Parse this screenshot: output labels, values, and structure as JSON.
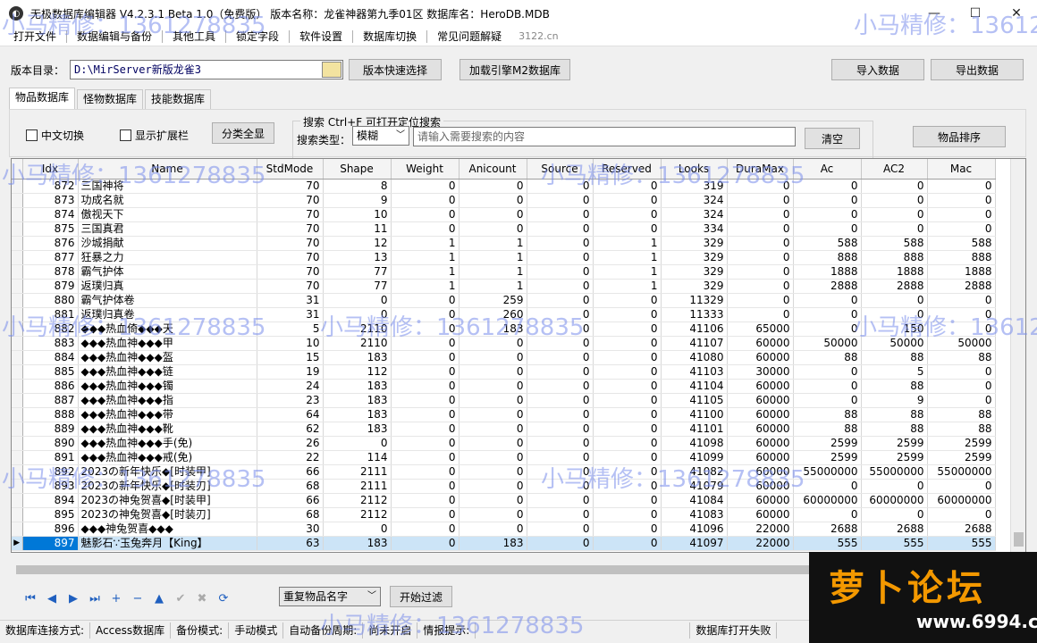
{
  "window": {
    "title": "无极数据库编辑器 V4.2.3.1    Beta 1.0（免费版）    版本名称：龙雀神器第九季01区    数据库名：HeroDB.MDB",
    "minimize": "—",
    "maximize": "☐",
    "close": "✕"
  },
  "menu": {
    "items": [
      "打开文件",
      "数据编辑与备份",
      "其他工具",
      "锁定字段",
      "软件设置",
      "数据库切换",
      "常见问题解疑"
    ],
    "website": "3122.cn"
  },
  "directory": {
    "label": "版本目录：",
    "value": "D:\\MirServer新版龙雀3",
    "quick_select": "版本快速选择",
    "load_engine": "加载引擎M2数据库",
    "import": "导入数据",
    "export": "导出数据"
  },
  "tabs": [
    "物品数据库",
    "怪物数据库",
    "技能数据库"
  ],
  "filters": {
    "chinese_toggle": "中文切换",
    "show_ext": "显示扩展栏",
    "show_all": "分类全显",
    "search_legend": "搜索   Ctrl+F 可打开定位搜索",
    "search_type_label": "搜索类型：",
    "search_type_value": "模糊",
    "search_placeholder": "请输入需要搜索的内容",
    "clear": "清空",
    "sort": "物品排序"
  },
  "table": {
    "columns": [
      "Idx",
      "Name",
      "StdMode",
      "Shape",
      "Weight",
      "Anicount",
      "Source",
      "Reserved",
      "Looks",
      "DuraMax",
      "Ac",
      "AC2",
      "Mac"
    ],
    "rows": [
      [
        "872",
        "三国神将",
        "70",
        "8",
        "0",
        "0",
        "0",
        "0",
        "319",
        "0",
        "0",
        "0",
        "0"
      ],
      [
        "873",
        "功成名就",
        "70",
        "9",
        "0",
        "0",
        "0",
        "0",
        "324",
        "0",
        "0",
        "0",
        "0"
      ],
      [
        "874",
        "傲视天下",
        "70",
        "10",
        "0",
        "0",
        "0",
        "0",
        "324",
        "0",
        "0",
        "0",
        "0"
      ],
      [
        "875",
        "三国真君",
        "70",
        "11",
        "0",
        "0",
        "0",
        "0",
        "334",
        "0",
        "0",
        "0",
        "0"
      ],
      [
        "876",
        "沙城捐献",
        "70",
        "12",
        "1",
        "1",
        "0",
        "1",
        "329",
        "0",
        "588",
        "588",
        "588"
      ],
      [
        "877",
        "狂暴之力",
        "70",
        "13",
        "1",
        "1",
        "0",
        "1",
        "329",
        "0",
        "888",
        "888",
        "888"
      ],
      [
        "878",
        "霸气护体",
        "70",
        "77",
        "1",
        "1",
        "0",
        "1",
        "329",
        "0",
        "1888",
        "1888",
        "1888"
      ],
      [
        "879",
        "返璞归真",
        "70",
        "77",
        "1",
        "1",
        "0",
        "1",
        "329",
        "0",
        "2888",
        "2888",
        "2888"
      ],
      [
        "880",
        "霸气护体卷",
        "31",
        "0",
        "0",
        "259",
        "0",
        "0",
        "11329",
        "0",
        "0",
        "0",
        "0"
      ],
      [
        "881",
        "返璞归真卷",
        "31",
        "0",
        "0",
        "260",
        "0",
        "0",
        "11333",
        "0",
        "0",
        "0",
        "0"
      ],
      [
        "882",
        "◆◆◆热血倚◆◆◆天",
        "5",
        "2110",
        "0",
        "183",
        "0",
        "0",
        "41106",
        "65000",
        "0",
        "150",
        "0"
      ],
      [
        "883",
        "◆◆◆热血神◆◆◆甲",
        "10",
        "2110",
        "0",
        "0",
        "0",
        "0",
        "41107",
        "60000",
        "50000",
        "50000",
        "50000"
      ],
      [
        "884",
        "◆◆◆热血神◆◆◆盔",
        "15",
        "183",
        "0",
        "0",
        "0",
        "0",
        "41080",
        "60000",
        "88",
        "88",
        "88"
      ],
      [
        "885",
        "◆◆◆热血神◆◆◆链",
        "19",
        "112",
        "0",
        "0",
        "0",
        "0",
        "41103",
        "30000",
        "0",
        "5",
        "0"
      ],
      [
        "886",
        "◆◆◆热血神◆◆◆镯",
        "24",
        "183",
        "0",
        "0",
        "0",
        "0",
        "41104",
        "60000",
        "0",
        "88",
        "0"
      ],
      [
        "887",
        "◆◆◆热血神◆◆◆指",
        "23",
        "183",
        "0",
        "0",
        "0",
        "0",
        "41105",
        "60000",
        "0",
        "9",
        "0"
      ],
      [
        "888",
        "◆◆◆热血神◆◆◆带",
        "64",
        "183",
        "0",
        "0",
        "0",
        "0",
        "41100",
        "60000",
        "88",
        "88",
        "88"
      ],
      [
        "889",
        "◆◆◆热血神◆◆◆靴",
        "62",
        "183",
        "0",
        "0",
        "0",
        "0",
        "41101",
        "60000",
        "88",
        "88",
        "88"
      ],
      [
        "890",
        "◆◆◆热血神◆◆◆手(免)",
        "26",
        "0",
        "0",
        "0",
        "0",
        "0",
        "41098",
        "60000",
        "2599",
        "2599",
        "2599"
      ],
      [
        "891",
        "◆◆◆热血神◆◆◆戒(免)",
        "22",
        "114",
        "0",
        "0",
        "0",
        "0",
        "41099",
        "60000",
        "2599",
        "2599",
        "2599"
      ],
      [
        "892",
        "2023の新年快乐◆[时装甲]",
        "66",
        "2111",
        "0",
        "0",
        "0",
        "0",
        "41082",
        "60000",
        "55000000",
        "55000000",
        "55000000"
      ],
      [
        "893",
        "2023の新年快乐◆[时装刃]",
        "68",
        "2111",
        "0",
        "0",
        "0",
        "0",
        "41079",
        "60000",
        "0",
        "0",
        "0"
      ],
      [
        "894",
        "2023の神兔贺喜◆[时装甲]",
        "66",
        "2112",
        "0",
        "0",
        "0",
        "0",
        "41084",
        "60000",
        "60000000",
        "60000000",
        "60000000"
      ],
      [
        "895",
        "2023の神兔贺喜◆[时装刃]",
        "68",
        "2112",
        "0",
        "0",
        "0",
        "0",
        "41083",
        "60000",
        "0",
        "0",
        "0"
      ],
      [
        "896",
        "◆◆◆神兔贺喜◆◆◆",
        "30",
        "0",
        "0",
        "0",
        "0",
        "0",
        "41096",
        "22000",
        "2688",
        "2688",
        "2688"
      ],
      [
        "897",
        "魅影石∵玉兔奔月【King】",
        "63",
        "183",
        "0",
        "183",
        "0",
        "0",
        "41097",
        "22000",
        "555",
        "555",
        "555"
      ]
    ],
    "selected_index": 25
  },
  "bottom": {
    "nav": [
      "⏮",
      "◀",
      "▶",
      "⏭",
      "+",
      "−",
      "▲",
      "✔",
      "✖",
      "⟳"
    ],
    "dup_select": "重复物品名字",
    "start_filter": "开始过滤"
  },
  "status": {
    "cells": [
      "数据库连接方式:",
      "Access数据库",
      "备份模式:",
      "手动模式",
      "自动备份周期:",
      "尚未开启",
      "情报提示:",
      "",
      "数据库打开失败"
    ]
  },
  "overlay": {
    "watermark": "小马精修：1361278835",
    "logo_text": "萝卜论坛",
    "logo_url": "www.6994.cn"
  }
}
